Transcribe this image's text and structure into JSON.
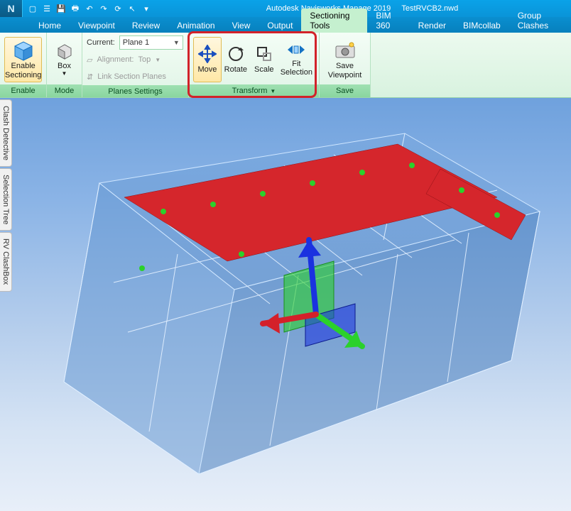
{
  "app": {
    "name": "Autodesk Navisworks Manage 2019",
    "document": "TestRVCB2.nwd"
  },
  "qat": {
    "items": [
      "new",
      "open",
      "save",
      "print",
      "undo",
      "redo",
      "refresh",
      "select"
    ]
  },
  "tabs": {
    "items": [
      "Home",
      "Viewpoint",
      "Review",
      "Animation",
      "View",
      "Output",
      "Sectioning Tools",
      "BIM 360",
      "Render",
      "BIMcollab",
      "Group Clashes"
    ],
    "active": "Sectioning Tools"
  },
  "ribbon": {
    "enable": {
      "label": "Enable\nSectioning",
      "panel": "Enable"
    },
    "mode": {
      "label": "Box",
      "panel": "Mode"
    },
    "planes": {
      "panel": "Planes Settings",
      "current_label": "Current:",
      "current_value": "Plane 1",
      "alignment_label": "Alignment:",
      "alignment_value": "Top",
      "link_label": "Link Section Planes"
    },
    "transform": {
      "panel": "Transform",
      "move": "Move",
      "rotate": "Rotate",
      "scale": "Scale",
      "fit": "Fit\nSelection"
    },
    "save": {
      "label": "Save\nViewpoint",
      "panel": "Save"
    }
  },
  "sidetabs": [
    "Clash Detective",
    "Selection Tree",
    "RV ClashBox"
  ],
  "viewport": {
    "gizmo": {
      "axes": [
        "x",
        "y",
        "z"
      ],
      "colors": {
        "x": "#d4202a",
        "y": "#2bd12b",
        "z": "#1a32e0"
      }
    }
  }
}
